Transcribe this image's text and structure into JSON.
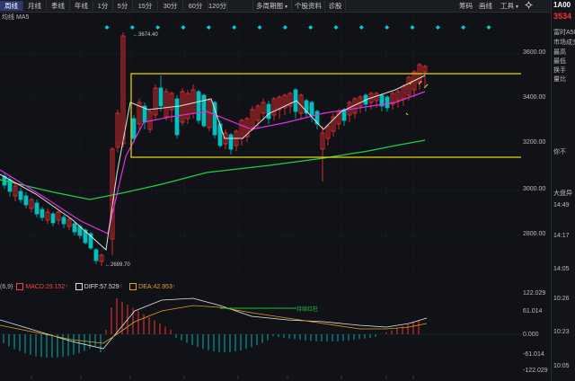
{
  "toolbar": {
    "periods": [
      "周线",
      "月线",
      "季线",
      "年线",
      "1分",
      "5分",
      "15分",
      "30分",
      "60分",
      "120分"
    ],
    "active_period": "周线",
    "multi_period": "多周期图",
    "dropdown_arrow": "▼",
    "profile": "个股资料",
    "diagnose": "诊股",
    "right_items": [
      "筹码",
      "画线",
      "工具"
    ],
    "tools_arrow": "▼",
    "code": "1A00"
  },
  "ma_legend": "均线 MA5",
  "main_chart": {
    "y_ticks": [
      "3600.00",
      "3400.00",
      "3200.00",
      "3000.00",
      "2800.00"
    ],
    "annotation_high": "3674.40",
    "annotation_low": "2689.70",
    "box_color": "#e8e000",
    "up_color": "#ff3030",
    "down_color": "#00c0c0",
    "ma5_color": "#e0e0e0",
    "ma10_color": "#e030e0",
    "ma20_color": "#20d040",
    "marker_color": "#00d0d0",
    "marker_count": 16
  },
  "macd": {
    "params": "(6,9)",
    "macd_label": "MACD:29.152",
    "macd_arrow": "↑",
    "diff_label": "DIFF:57.529",
    "diff_arrow": "↑",
    "dea_label": "DEA:42.953",
    "dea_arrow": "↑",
    "y_ticks": [
      "122.029",
      "61.014",
      "0.000",
      "-61.014",
      "-122.029"
    ],
    "signal_text": "持续红柱",
    "diff_color": "#e8e8e8",
    "dea_color": "#e0a020"
  },
  "right_panel": {
    "price": "3534",
    "labels": [
      "富时A50",
      "市场成交",
      "最高",
      "最低",
      "换手",
      "量比"
    ],
    "wind_text": "你不",
    "market_text": "大盘异",
    "times": [
      "14:49",
      "14:17",
      "14:05",
      "10:26",
      "10:23",
      "10:05"
    ]
  }
}
